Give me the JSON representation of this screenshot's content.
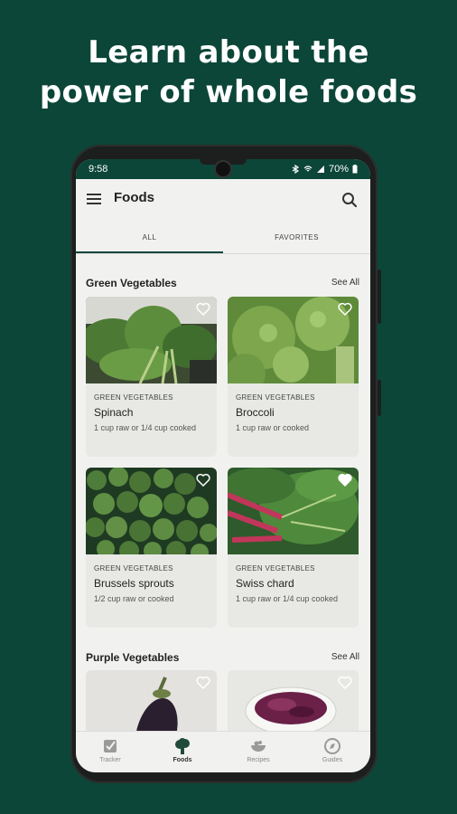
{
  "headline": {
    "line1": "Learn about the",
    "line2": "power of whole foods"
  },
  "status": {
    "time": "9:58",
    "battery": "70%"
  },
  "appbar": {
    "title": "Foods"
  },
  "tabs": [
    {
      "label": "ALL"
    },
    {
      "label": "FAVORITES"
    }
  ],
  "sections": [
    {
      "title": "Green Vegetables",
      "see_all": "See All"
    },
    {
      "title": "Purple Vegetables",
      "see_all": "See All"
    }
  ],
  "cards": [
    {
      "category": "GREEN VEGETABLES",
      "name": "Spinach",
      "serving": "1 cup raw or 1/4 cup cooked"
    },
    {
      "category": "GREEN VEGETABLES",
      "name": "Broccoli",
      "serving": "1 cup raw or cooked"
    },
    {
      "category": "GREEN VEGETABLES",
      "name": "Brussels sprouts",
      "serving": "1/2 cup raw or cooked"
    },
    {
      "category": "GREEN VEGETABLES",
      "name": "Swiss chard",
      "serving": "1 cup raw or 1/4 cup cooked"
    }
  ],
  "nav": [
    {
      "label": "Tracker",
      "icon": "checkbox-icon"
    },
    {
      "label": "Foods",
      "icon": "broccoli-icon"
    },
    {
      "label": "Recipes",
      "icon": "bowl-icon"
    },
    {
      "label": "Guides",
      "icon": "compass-icon"
    }
  ],
  "colors": {
    "brand": "#0b4638",
    "screen_bg": "#f1f1ef",
    "card_bg": "#e8e8e5"
  }
}
